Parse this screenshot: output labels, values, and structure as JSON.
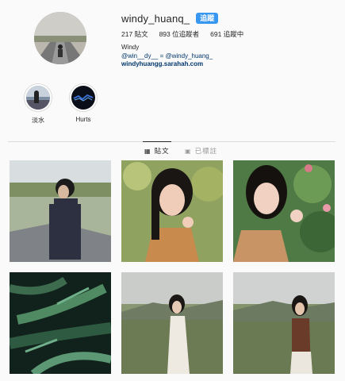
{
  "profile": {
    "username": "windy_huanq_",
    "follow_label": "追蹤",
    "stats": [
      {
        "value": "217",
        "label": "貼文"
      },
      {
        "value": "893",
        "label": "位追蹤者"
      },
      {
        "value": "691",
        "label": "追蹤中"
      }
    ],
    "bio_name": "Windy",
    "bio_handles": "@win__dy__ = @windy_huang_",
    "bio_site": "windyhuangg.sarahah.com"
  },
  "highlights": [
    {
      "label": "淡水",
      "icon": "highlight-tamsui-thumbnail"
    },
    {
      "label": "Hurts",
      "icon": "highlight-hurts-thumbnail"
    }
  ],
  "tabs": [
    {
      "label": "貼文",
      "icon": "grid-icon",
      "active": true
    },
    {
      "label": "已標註",
      "icon": "tag-icon",
      "active": false
    }
  ],
  "colors": {
    "accent": "#3897f0",
    "link": "#00376b",
    "divider": "#dbdbdb"
  }
}
